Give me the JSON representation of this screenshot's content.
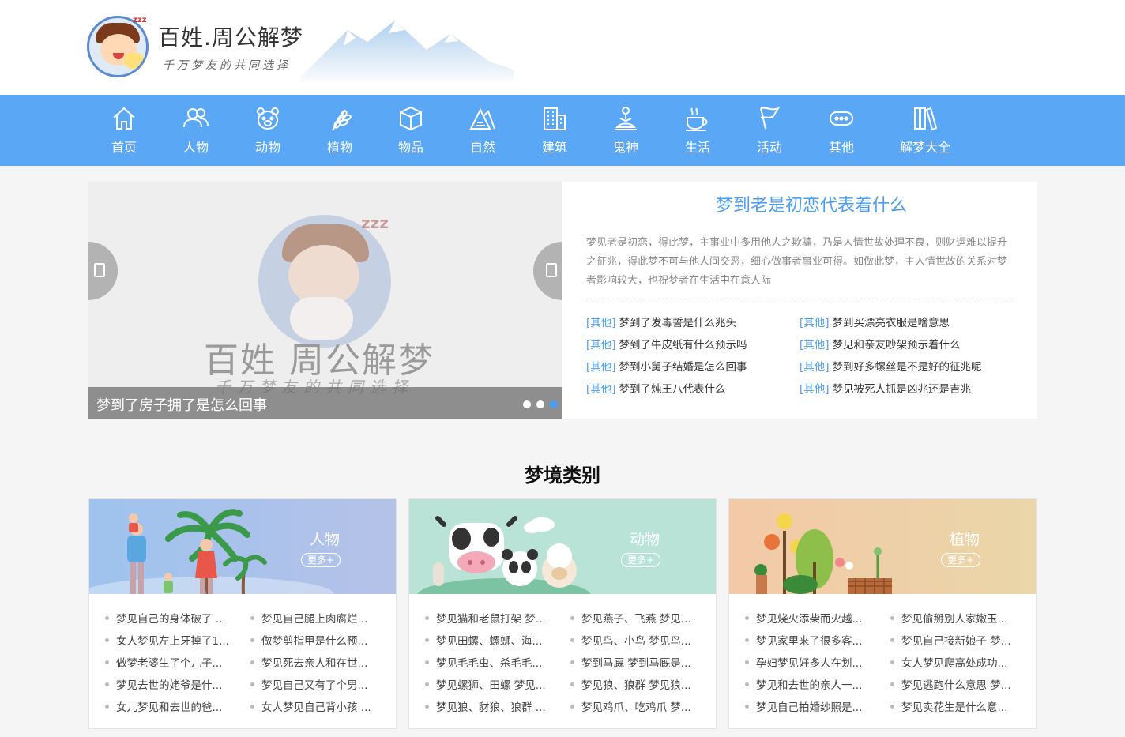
{
  "header": {
    "site_title": "百姓.周公解梦",
    "site_slogan": "千万梦友的共同选择"
  },
  "nav": [
    {
      "label": "首页",
      "icon": "home-icon"
    },
    {
      "label": "人物",
      "icon": "people-icon"
    },
    {
      "label": "动物",
      "icon": "bear-icon"
    },
    {
      "label": "植物",
      "icon": "wheat-icon"
    },
    {
      "label": "物品",
      "icon": "box-icon"
    },
    {
      "label": "自然",
      "icon": "mountain-icon"
    },
    {
      "label": "建筑",
      "icon": "building-icon"
    },
    {
      "label": "鬼神",
      "icon": "buddha-icon"
    },
    {
      "label": "生活",
      "icon": "coffee-icon"
    },
    {
      "label": "活动",
      "icon": "flag-icon"
    },
    {
      "label": "其他",
      "icon": "chat-icon"
    },
    {
      "label": "解梦大全",
      "icon": "books-icon"
    }
  ],
  "slider": {
    "image_title": "百姓 周公解梦",
    "image_subtitle": "千万梦友的共同选择",
    "caption": "梦到了房子拥了是怎么回事",
    "slide_count": 3,
    "active_slide": 3
  },
  "featured": {
    "title": "梦到老是初恋代表着什么",
    "description": "梦见老是初恋，得此梦，主事业中多用他人之欺骗，乃是人情世故处理不良，则财运难以提升之征兆，得此梦不可与他人间交恶，细心做事者事业可得。如做此梦，主人情世故的关系对梦者影响较大，也祝梦者在生活中在意人际",
    "links": [
      {
        "tag": "[其他]",
        "text": "梦到了发毒誓是什么兆头"
      },
      {
        "tag": "[其他]",
        "text": "梦到买漂亮衣服是啥意思"
      },
      {
        "tag": "[其他]",
        "text": "梦到了牛皮纸有什么预示吗"
      },
      {
        "tag": "[其他]",
        "text": "梦见和亲友吵架预示着什么"
      },
      {
        "tag": "[其他]",
        "text": "梦到小舅子结婚是怎么回事"
      },
      {
        "tag": "[其他]",
        "text": "梦到好多螺丝是不是好的征兆呢"
      },
      {
        "tag": "[其他]",
        "text": "梦到了炖王八代表什么"
      },
      {
        "tag": "[其他]",
        "text": "梦见被死人抓是凶兆还是吉兆"
      }
    ]
  },
  "section_title": "梦境类别",
  "categories": [
    {
      "name": "人物",
      "more": "更多+",
      "items": [
        "梦见自己的身体破了 ...",
        "梦见自己腿上肉腐烂...",
        "女人梦见左上牙掉了1...",
        "做梦剪指甲是什么预...",
        "做梦老婆生了个儿子...",
        "梦见死去亲人和在世...",
        "梦见去世的姥爷是什...",
        "梦见自己又有了个男...",
        "女儿梦见和去世的爸...",
        "女人梦见自己背小孩 ..."
      ]
    },
    {
      "name": "动物",
      "more": "更多+",
      "items": [
        "梦见猫和老鼠打架 梦...",
        "梦见燕子、飞燕 梦见...",
        "梦见田螺、螺蛳、海...",
        "梦见鸟、小鸟 梦见鸟...",
        "梦见毛毛虫、杀毛毛...",
        "梦到马厩 梦到马厩是...",
        "梦见螺狮、田螺 梦见...",
        "梦见狼、狼群 梦见狼...",
        "梦见狼、豺狼、狼群 ...",
        "梦见鸡爪、吃鸡爪 梦..."
      ]
    },
    {
      "name": "植物",
      "more": "更多+",
      "items": [
        "梦见烧火添柴而火越...",
        "梦见偷掰别人家嫩玉...",
        "梦见家里来了很多客...",
        "梦见自己接新娘子 梦...",
        "孕妇梦见好多人在划...",
        "女人梦见爬高处成功...",
        "梦见和去世的亲人一...",
        "梦见逃跑什么意思 梦...",
        "梦见自己拍婚纱照是...",
        "梦见卖花生是什么意..."
      ]
    }
  ],
  "colors": {
    "nav_bg": "#5aa7f5",
    "accent": "#4a9ef0",
    "page_bg": "#f5f5f5"
  }
}
